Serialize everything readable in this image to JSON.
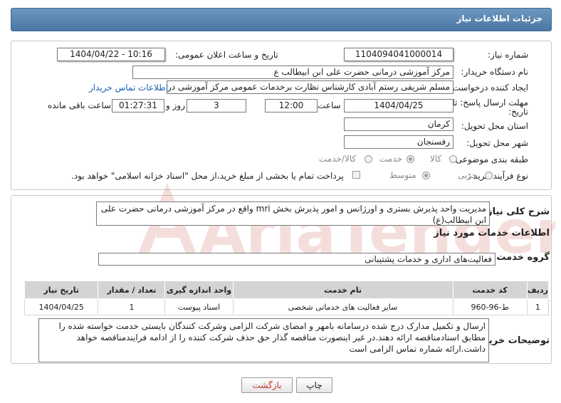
{
  "header": {
    "title": "جزئیات اطلاعات نیاز"
  },
  "fields": {
    "need_number_label": "شماره نیاز:",
    "need_number": "1104094041000014",
    "announce_label": "تاریخ و ساعت اعلان عمومی:",
    "announce_value": "1404/04/22 - 10:16",
    "buyer_org_label": "نام دستگاه خریدار:",
    "buyer_org": "مرکز آموزشی  درمانی حضرت علی ابن ابیطالب ع",
    "creator_label": "ایجاد کننده درخواست:",
    "creator": "مسلم شریفی رستم آبادی کارشناس نظارت برخدمات عمومی مرکز آموزشی  در",
    "contact_link": "اطلاعات تماس خریدار",
    "deadline_label_1": "مهلت ارسال پاسخ: تا",
    "deadline_label_2": "تاریخ:",
    "deadline_date": "1404/04/25",
    "time_label": "ساعت",
    "deadline_time": "12:00",
    "days_value": "3",
    "days_label": "روز و",
    "remaining_value": "01:27:31",
    "remaining_label": "ساعت باقی مانده",
    "province_label": "استان محل تحویل:",
    "province": "کرمان",
    "city_label": "شهر محل تحویل:",
    "city": "رفسنجان",
    "category_label": "طبقه بندی موضوعی:",
    "category_options": [
      "کالا",
      "خدمت",
      "کالا/خدمت"
    ],
    "category_selected": "خدمت",
    "process_label": "نوع فرآیند خرید :",
    "process_options": [
      "جزیی",
      "متوسط"
    ],
    "process_selected": "متوسط",
    "payment_note": "پرداخت تمام یا بخشی از مبلغ خرید،از محل \"اسناد خزانه اسلامی\" خواهد بود."
  },
  "description": {
    "label": "شرح کلی نیاز:",
    "text": "مدیریت واحد پذیرش بستری و اورژانس و امور پذیرش بخش mri واقع در مرکز آموزشی درمانی حضرت علی ابن ابیطالب(ع)"
  },
  "services": {
    "section_title": "اطلاعات خدمات مورد نیاز",
    "group_label": "گروه خدمت:",
    "group_value": "فعالیت‌های اداری و خدمات پشتیبانی",
    "columns": [
      "ردیف",
      "کد خدمت",
      "نام خدمت",
      "واحد اندازه گیری",
      "تعداد / مقدار",
      "تاریخ نیاز"
    ],
    "rows": [
      [
        "1",
        "ط-96-960",
        "سایر فعالیت های خدماتی شخصی",
        "اسناد پیوست",
        "1",
        "1404/04/25"
      ]
    ]
  },
  "buyer_notes": {
    "label": "توضیحات خریدار:",
    "text": "ارسال و تکمیل مدارک درج شده درسامانه بامهر و امضای شرکت الزامی وشرکت کنندگان بایستی خدمت خواسته شده را مطابق اسنادمناقصه ارائه دهند.در غیر اینصورت مناقصه گذار حق حذف شرکت کننده را از ادامه فرایندمناقصه خواهد داشت.ارائه شماره تماس الزامی است"
  },
  "buttons": {
    "print": "چاپ",
    "back": "بازگشت"
  },
  "watermark": {
    "text": "AriaTender.neT"
  },
  "colors": {
    "title_bg": "#5a86b2",
    "link": "#1a5fb4",
    "back_text": "#c0392b",
    "watermark": "#c0392b"
  }
}
